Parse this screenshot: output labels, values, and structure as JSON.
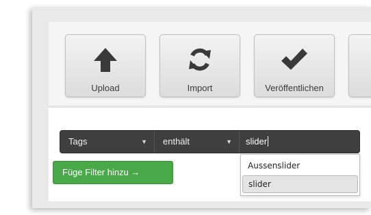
{
  "toolbar": {
    "buttons": [
      {
        "label": "Upload",
        "icon": "upload-arrow-icon"
      },
      {
        "label": "Import",
        "icon": "refresh-icon"
      },
      {
        "label": "Veröffentlichen",
        "icon": "checkmark-icon"
      },
      {
        "label": "",
        "icon": "unknown"
      }
    ]
  },
  "filter": {
    "field": "Tags",
    "operator": "enthält",
    "value": "slider",
    "add_filter_label": "Füge Filter hinzu →",
    "suggestions": [
      "Aussenslider",
      "slider"
    ],
    "highlighted_suggestion": "slider"
  },
  "colors": {
    "filter_bar": "#3f3f3f",
    "add_filter_button": "#49a949",
    "icon": "#3a3a3a"
  }
}
